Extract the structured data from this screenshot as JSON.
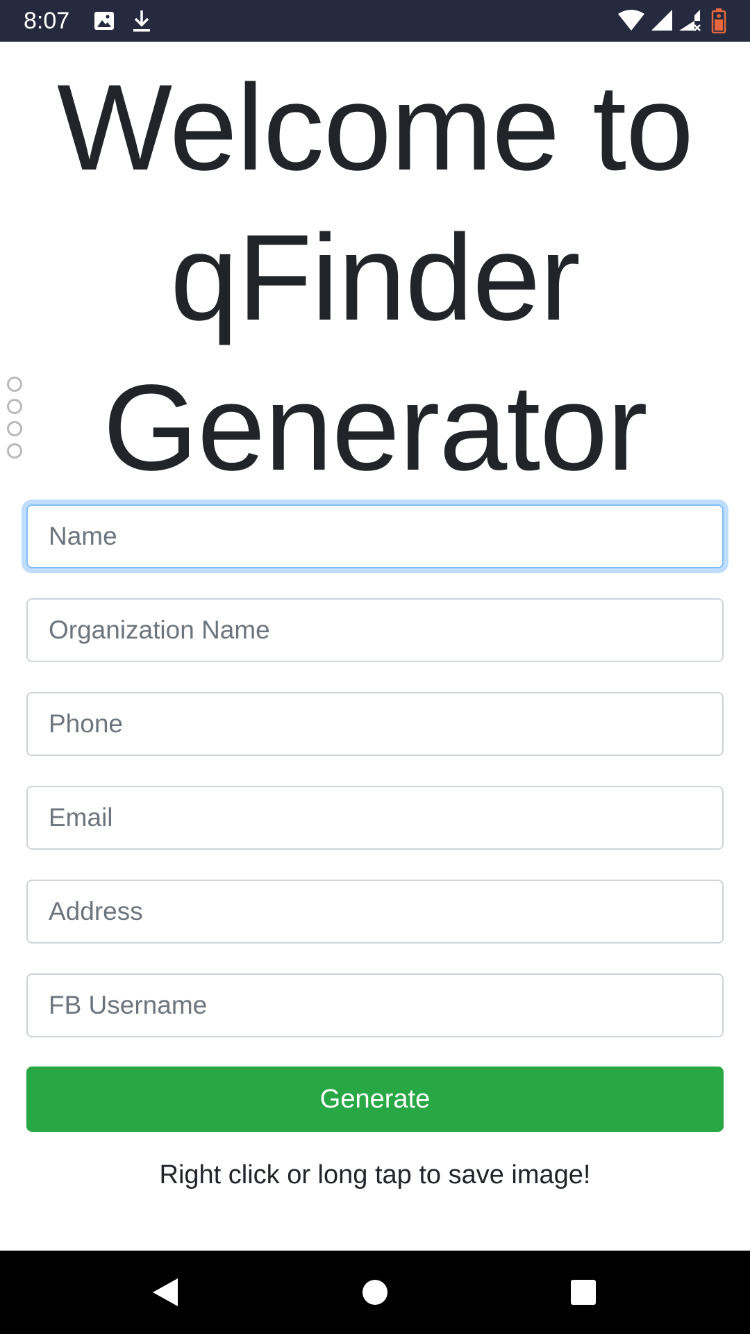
{
  "status_bar": {
    "time": "8:07",
    "left_icons": [
      "image-icon",
      "download-icon"
    ],
    "right_icons": [
      "wifi-icon",
      "signal-icon",
      "signal-no-data-icon",
      "battery-low-icon"
    ],
    "battery_color": "#e8663d"
  },
  "page": {
    "title_lines": [
      "Welcome to",
      "qFinder",
      "Generator"
    ]
  },
  "form": {
    "fields": [
      {
        "placeholder": "Name",
        "value": "",
        "focused": true
      },
      {
        "placeholder": "Organization Name",
        "value": ""
      },
      {
        "placeholder": "Phone",
        "value": ""
      },
      {
        "placeholder": "Email",
        "value": ""
      },
      {
        "placeholder": "Address",
        "value": ""
      },
      {
        "placeholder": "FB Username",
        "value": ""
      }
    ],
    "submit_label": "Generate",
    "submit_color": "#28a745",
    "focus_color": "#80bdff"
  },
  "hint": "Right click or long tap to save image!",
  "nav_bar": {
    "buttons": [
      "back-icon",
      "home-icon",
      "recents-icon"
    ]
  }
}
